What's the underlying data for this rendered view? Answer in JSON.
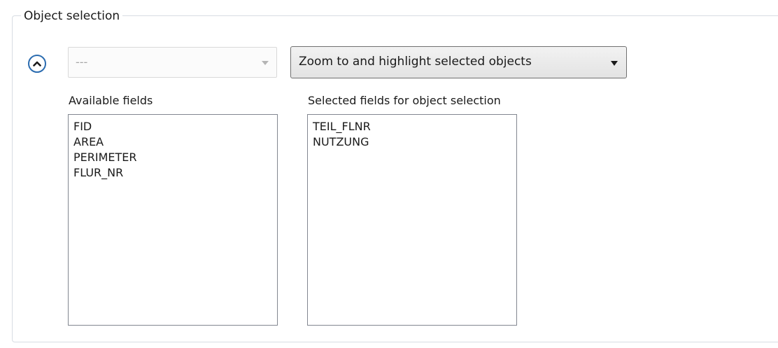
{
  "group": {
    "title": "Object selection"
  },
  "icons": {
    "collapse": "chevron-up-circle-icon",
    "dropdown": "caret-down-icon"
  },
  "layer_combo": {
    "value": "---",
    "enabled": false
  },
  "action_combo": {
    "value": "Zoom to and highlight selected objects"
  },
  "available_fields": {
    "label": "Available fields",
    "items": [
      "FID",
      "AREA",
      "PERIMETER",
      "FLUR_NR"
    ]
  },
  "selected_fields": {
    "label": "Selected fields for object selection",
    "items": [
      "TEIL_FLNR",
      "NUTZUNG"
    ]
  },
  "colors": {
    "accent": "#2b6cb0",
    "border": "#828790",
    "group_border": "#d8dde3"
  }
}
